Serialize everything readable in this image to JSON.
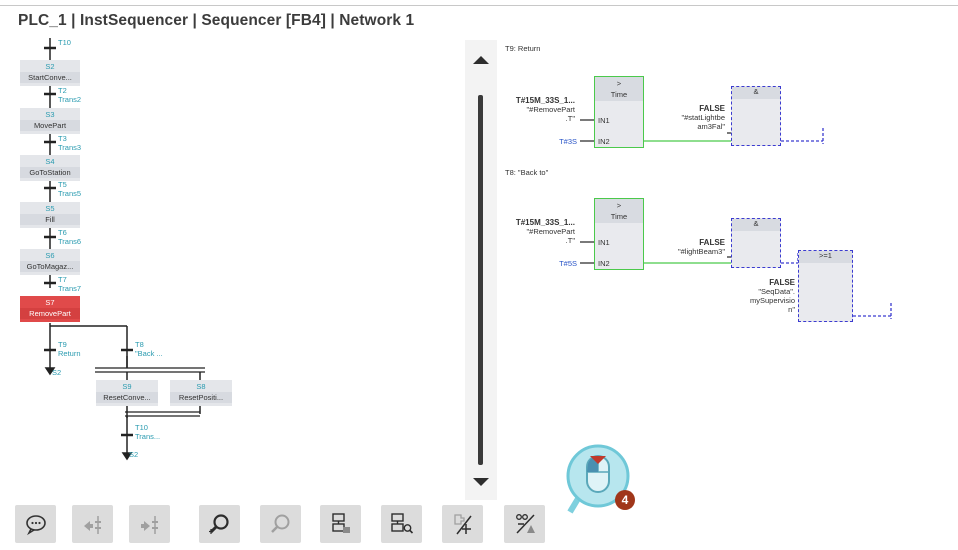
{
  "header": {
    "title": "PLC_1 | InstSequencer | Sequencer [FB4] | Network 1"
  },
  "graph": {
    "top_transition": "T10",
    "steps": [
      {
        "num": "S2",
        "name": "StartConve..."
      },
      {
        "num": "S3",
        "name": "MovePart"
      },
      {
        "num": "S4",
        "name": "GoToStation"
      },
      {
        "num": "S5",
        "name": "Fill"
      },
      {
        "num": "S6",
        "name": "GoToMagaz..."
      },
      {
        "num": "S7",
        "name": "RemovePart"
      },
      {
        "num": "S9",
        "name": "ResetConve..."
      },
      {
        "num": "S8",
        "name": "ResetPositi..."
      }
    ],
    "transitions": [
      {
        "num": "T2",
        "name": "Trans2"
      },
      {
        "num": "T3",
        "name": "Trans3"
      },
      {
        "num": "T5",
        "name": "Trans5"
      },
      {
        "num": "T6",
        "name": "Trans6"
      },
      {
        "num": "T7",
        "name": "Trans7"
      },
      {
        "num": "T9",
        "name": "Return"
      },
      {
        "num": "T8",
        "name": "\"Back ..."
      },
      {
        "num": "T10",
        "name": "Trans..."
      }
    ],
    "jumps": [
      "S2",
      "S2"
    ]
  },
  "fbd": {
    "t9": {
      "label": "T9: Return",
      "cmp_op": ">",
      "cmp_type": "Time",
      "in1_top": "T#15M_33S_1...",
      "in1_mid": "\"#RemovePart",
      "in1_bot": ".T\"",
      "in1": "IN1",
      "in2_val": "T#3S",
      "in2": "IN2",
      "and_op": "&",
      "false": "FALSE",
      "op_line1": "\"#statLightbe",
      "op_line2": "am3Fal\""
    },
    "t8": {
      "label": "T8: \"Back to\"",
      "cmp_op": ">",
      "cmp_type": "Time",
      "in1_top": "T#15M_33S_1...",
      "in1_mid": "\"#RemovePart",
      "in1_bot": ".T\"",
      "in1": "IN1",
      "in2_val": "T#5S",
      "in2": "IN2",
      "and_op": "&",
      "false1": "FALSE",
      "op1": "\"#lightBeam3\"",
      "or_op": ">=1",
      "false2": "FALSE",
      "op2_line1": "\"SeqData\".",
      "op2_line2": "mySupervisio",
      "op2_line3": "n\""
    }
  },
  "toolbar": {
    "buttons": [
      "comment-icon",
      "prev-branch-icon",
      "next-branch-icon",
      "zoom-in-icon",
      "zoom-out-icon",
      "overview-icon",
      "zoom-fit-icon",
      "insert-transition-icon",
      "show-hide-transitions-icon"
    ]
  },
  "callout": {
    "badge": "4"
  }
}
